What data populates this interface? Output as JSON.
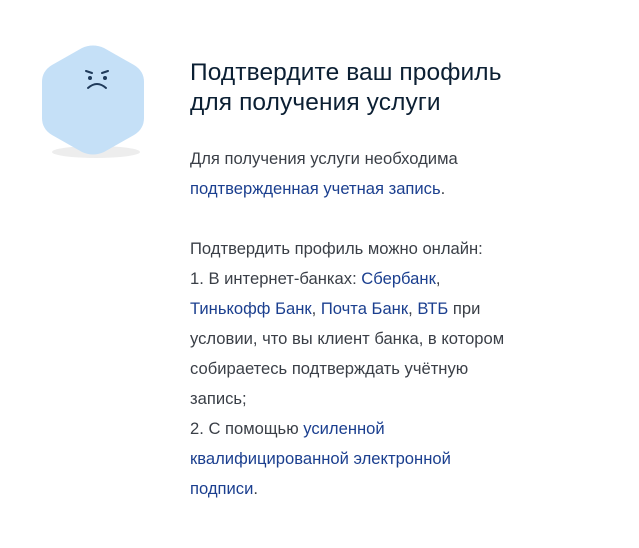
{
  "illustration": {
    "icon": "sad-face-hexagon-icon",
    "colors": {
      "shape": "#c5e0f7",
      "face": "#1f3a5a",
      "shadow": "#ececec"
    }
  },
  "title": {
    "line1": "Подтвердите ваш профиль",
    "line2": "для получения услуги"
  },
  "intro": {
    "text": "Для получения услуги необходима",
    "link": "подтвержденная учетная запись",
    "end": "."
  },
  "online": {
    "heading": "Подтвердить профиль можно онлайн:",
    "item1_prefix": "1. В интернет-банках: ",
    "banks": [
      "Сбербанк",
      "Тинькофф Банк",
      "Почта Банк",
      "ВТБ"
    ],
    "sep": ", ",
    "item1_suffix_a": " при",
    "item1_suffix_b": "условии, что вы клиент банка, в котором",
    "item1_suffix_c": "собираетесь подтверждать учётную",
    "item1_suffix_d": "запись;",
    "item2_prefix": "2. С помощью ",
    "item2_link_a": "усиленной",
    "item2_link_b": "квалифицированной электронной",
    "item2_link_c": "подписи",
    "item2_end": "."
  },
  "colors": {
    "title": "#0b1f33",
    "text": "#3a3f47",
    "link": "#0d4cd3"
  }
}
